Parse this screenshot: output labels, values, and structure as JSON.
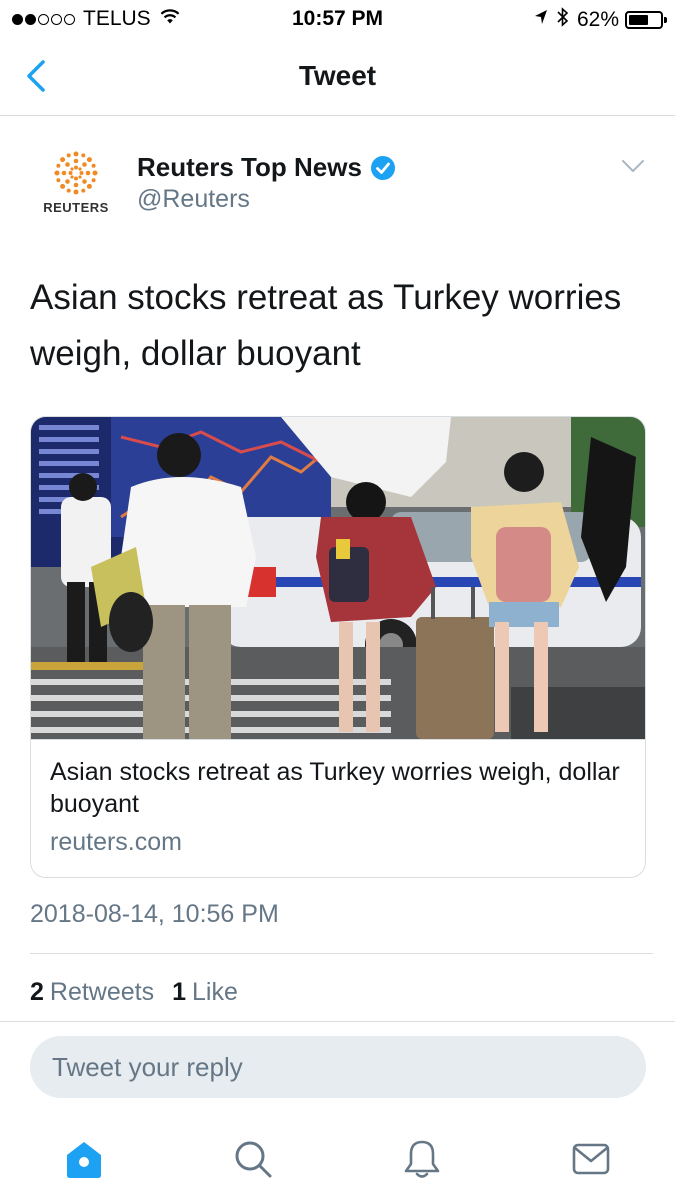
{
  "status_bar": {
    "carrier": "TELUS",
    "time": "10:57 PM",
    "battery_percent": "62%",
    "battery_level": 0.62,
    "signal_bars_filled": 2,
    "signal_bars_total": 5
  },
  "nav": {
    "title": "Tweet",
    "back_icon": "chevron-left-icon",
    "accent_color": "#1da1f2"
  },
  "tweet": {
    "author": {
      "display_name": "Reuters Top News",
      "handle": "@Reuters",
      "avatar_label": "REUTERS",
      "verified": true
    },
    "text": "Asian stocks retreat as Turkey worries weigh, dollar buoyant",
    "card": {
      "title": "Asian stocks retreat as Turkey worries weigh, dollar buoyant",
      "domain": "reuters.com"
    },
    "timestamp": "2018-08-14, 10:56 PM",
    "stats": {
      "retweets_count": "2",
      "retweets_label": "Retweets",
      "likes_count": "1",
      "likes_label": "Like"
    }
  },
  "reply": {
    "placeholder": "Tweet your reply"
  },
  "tabs": [
    {
      "icon": "home-icon",
      "active": true
    },
    {
      "icon": "search-icon",
      "active": false
    },
    {
      "icon": "bell-icon",
      "active": false
    },
    {
      "icon": "mail-icon",
      "active": false
    }
  ]
}
